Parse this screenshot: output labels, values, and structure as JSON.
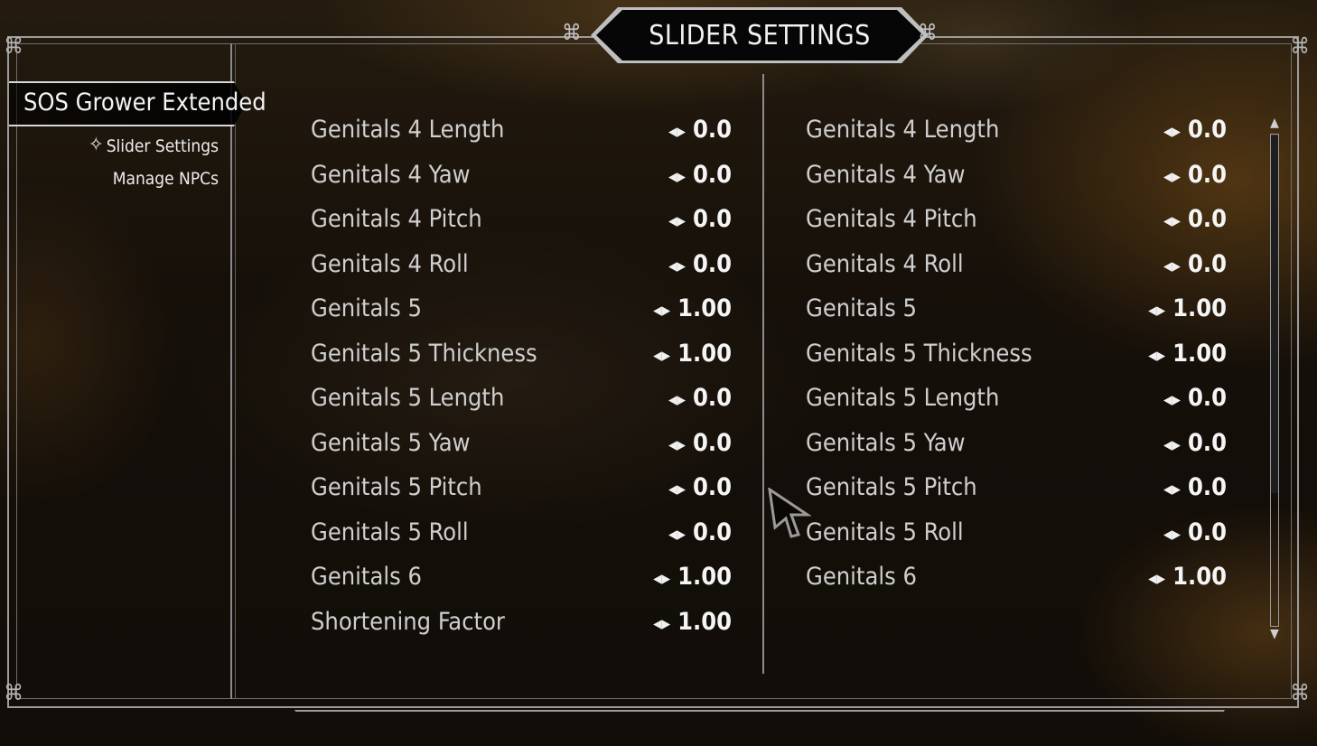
{
  "title": "SLIDER SETTINGS",
  "sidebar": {
    "mod_name": "SOS Grower Extended",
    "pages": [
      {
        "label": "Slider Settings",
        "selected": true
      },
      {
        "label": "Manage NPCs",
        "selected": false
      }
    ]
  },
  "left_column": [
    {
      "label": "Genitals 4 Length",
      "value": "0.0"
    },
    {
      "label": "Genitals 4 Yaw",
      "value": "0.0"
    },
    {
      "label": "Genitals 4 Pitch",
      "value": "0.0"
    },
    {
      "label": "Genitals 4 Roll",
      "value": "0.0"
    },
    {
      "label": "Genitals 5",
      "value": "1.00"
    },
    {
      "label": "Genitals 5 Thickness",
      "value": "1.00"
    },
    {
      "label": "Genitals 5 Length",
      "value": "0.0"
    },
    {
      "label": "Genitals 5 Yaw",
      "value": "0.0"
    },
    {
      "label": "Genitals 5 Pitch",
      "value": "0.0"
    },
    {
      "label": "Genitals 5 Roll",
      "value": "0.0"
    },
    {
      "label": "Genitals 6",
      "value": "1.00"
    },
    {
      "label": "Shortening Factor",
      "value": "1.00"
    }
  ],
  "right_column": [
    {
      "label": "Genitals 4 Length",
      "value": "0.0"
    },
    {
      "label": "Genitals 4 Yaw",
      "value": "0.0"
    },
    {
      "label": "Genitals 4 Pitch",
      "value": "0.0"
    },
    {
      "label": "Genitals 4 Roll",
      "value": "0.0"
    },
    {
      "label": "Genitals 5",
      "value": "1.00"
    },
    {
      "label": "Genitals 5 Thickness",
      "value": "1.00"
    },
    {
      "label": "Genitals 5 Length",
      "value": "0.0"
    },
    {
      "label": "Genitals 5 Yaw",
      "value": "0.0"
    },
    {
      "label": "Genitals 5 Pitch",
      "value": "0.0"
    },
    {
      "label": "Genitals 5 Roll",
      "value": "0.0"
    },
    {
      "label": "Genitals 6",
      "value": "1.00"
    }
  ],
  "slider_icon": "slider-arrows-icon",
  "scrollbar": {
    "position": 0.0,
    "visible_fraction": 0.73
  },
  "colors": {
    "text": "#cfcfcf",
    "value": "#f5f5f5",
    "frame": "#9c9c9c"
  }
}
